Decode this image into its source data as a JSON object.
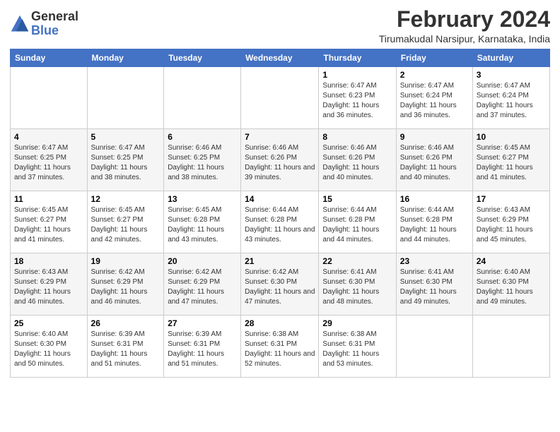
{
  "logo": {
    "line1": "General",
    "line2": "Blue"
  },
  "title": "February 2024",
  "location": "Tirumakudal Narsipur, Karnataka, India",
  "days_of_week": [
    "Sunday",
    "Monday",
    "Tuesday",
    "Wednesday",
    "Thursday",
    "Friday",
    "Saturday"
  ],
  "weeks": [
    [
      {
        "num": "",
        "info": ""
      },
      {
        "num": "",
        "info": ""
      },
      {
        "num": "",
        "info": ""
      },
      {
        "num": "",
        "info": ""
      },
      {
        "num": "1",
        "info": "Sunrise: 6:47 AM\nSunset: 6:23 PM\nDaylight: 11 hours and 36 minutes."
      },
      {
        "num": "2",
        "info": "Sunrise: 6:47 AM\nSunset: 6:24 PM\nDaylight: 11 hours and 36 minutes."
      },
      {
        "num": "3",
        "info": "Sunrise: 6:47 AM\nSunset: 6:24 PM\nDaylight: 11 hours and 37 minutes."
      }
    ],
    [
      {
        "num": "4",
        "info": "Sunrise: 6:47 AM\nSunset: 6:25 PM\nDaylight: 11 hours and 37 minutes."
      },
      {
        "num": "5",
        "info": "Sunrise: 6:47 AM\nSunset: 6:25 PM\nDaylight: 11 hours and 38 minutes."
      },
      {
        "num": "6",
        "info": "Sunrise: 6:46 AM\nSunset: 6:25 PM\nDaylight: 11 hours and 38 minutes."
      },
      {
        "num": "7",
        "info": "Sunrise: 6:46 AM\nSunset: 6:26 PM\nDaylight: 11 hours and 39 minutes."
      },
      {
        "num": "8",
        "info": "Sunrise: 6:46 AM\nSunset: 6:26 PM\nDaylight: 11 hours and 40 minutes."
      },
      {
        "num": "9",
        "info": "Sunrise: 6:46 AM\nSunset: 6:26 PM\nDaylight: 11 hours and 40 minutes."
      },
      {
        "num": "10",
        "info": "Sunrise: 6:45 AM\nSunset: 6:27 PM\nDaylight: 11 hours and 41 minutes."
      }
    ],
    [
      {
        "num": "11",
        "info": "Sunrise: 6:45 AM\nSunset: 6:27 PM\nDaylight: 11 hours and 41 minutes."
      },
      {
        "num": "12",
        "info": "Sunrise: 6:45 AM\nSunset: 6:27 PM\nDaylight: 11 hours and 42 minutes."
      },
      {
        "num": "13",
        "info": "Sunrise: 6:45 AM\nSunset: 6:28 PM\nDaylight: 11 hours and 43 minutes."
      },
      {
        "num": "14",
        "info": "Sunrise: 6:44 AM\nSunset: 6:28 PM\nDaylight: 11 hours and 43 minutes."
      },
      {
        "num": "15",
        "info": "Sunrise: 6:44 AM\nSunset: 6:28 PM\nDaylight: 11 hours and 44 minutes."
      },
      {
        "num": "16",
        "info": "Sunrise: 6:44 AM\nSunset: 6:28 PM\nDaylight: 11 hours and 44 minutes."
      },
      {
        "num": "17",
        "info": "Sunrise: 6:43 AM\nSunset: 6:29 PM\nDaylight: 11 hours and 45 minutes."
      }
    ],
    [
      {
        "num": "18",
        "info": "Sunrise: 6:43 AM\nSunset: 6:29 PM\nDaylight: 11 hours and 46 minutes."
      },
      {
        "num": "19",
        "info": "Sunrise: 6:42 AM\nSunset: 6:29 PM\nDaylight: 11 hours and 46 minutes."
      },
      {
        "num": "20",
        "info": "Sunrise: 6:42 AM\nSunset: 6:29 PM\nDaylight: 11 hours and 47 minutes."
      },
      {
        "num": "21",
        "info": "Sunrise: 6:42 AM\nSunset: 6:30 PM\nDaylight: 11 hours and 47 minutes."
      },
      {
        "num": "22",
        "info": "Sunrise: 6:41 AM\nSunset: 6:30 PM\nDaylight: 11 hours and 48 minutes."
      },
      {
        "num": "23",
        "info": "Sunrise: 6:41 AM\nSunset: 6:30 PM\nDaylight: 11 hours and 49 minutes."
      },
      {
        "num": "24",
        "info": "Sunrise: 6:40 AM\nSunset: 6:30 PM\nDaylight: 11 hours and 49 minutes."
      }
    ],
    [
      {
        "num": "25",
        "info": "Sunrise: 6:40 AM\nSunset: 6:30 PM\nDaylight: 11 hours and 50 minutes."
      },
      {
        "num": "26",
        "info": "Sunrise: 6:39 AM\nSunset: 6:31 PM\nDaylight: 11 hours and 51 minutes."
      },
      {
        "num": "27",
        "info": "Sunrise: 6:39 AM\nSunset: 6:31 PM\nDaylight: 11 hours and 51 minutes."
      },
      {
        "num": "28",
        "info": "Sunrise: 6:38 AM\nSunset: 6:31 PM\nDaylight: 11 hours and 52 minutes."
      },
      {
        "num": "29",
        "info": "Sunrise: 6:38 AM\nSunset: 6:31 PM\nDaylight: 11 hours and 53 minutes."
      },
      {
        "num": "",
        "info": ""
      },
      {
        "num": "",
        "info": ""
      }
    ]
  ]
}
